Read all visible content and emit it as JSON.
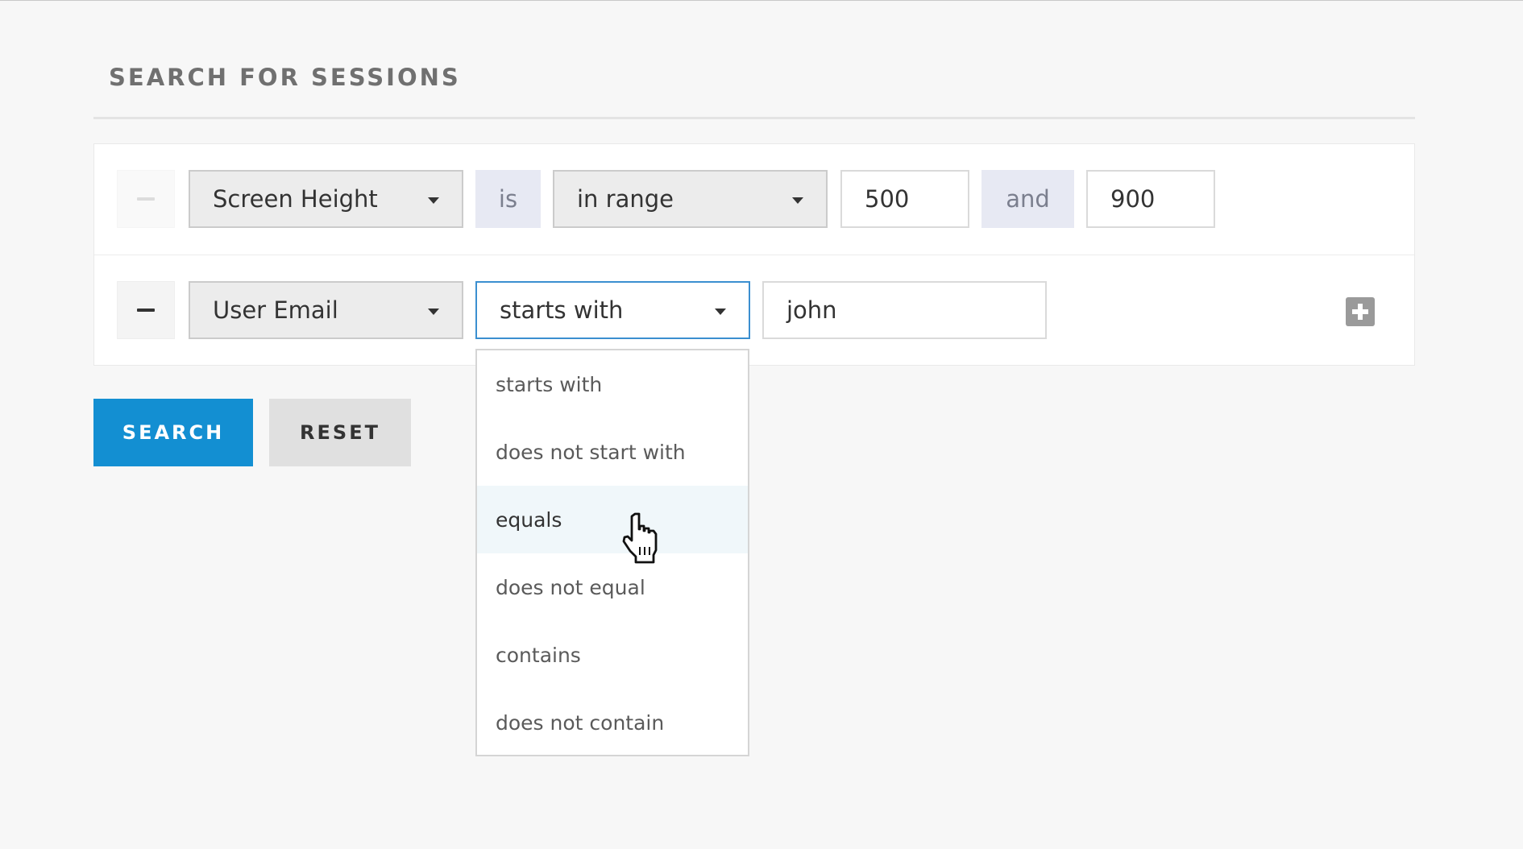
{
  "page": {
    "title": "SEARCH FOR SESSIONS"
  },
  "filters": [
    {
      "field": "Screen Height",
      "connector": "is",
      "operator": "in range",
      "value_from": "500",
      "range_joiner": "and",
      "value_to": "900"
    },
    {
      "field": "User Email",
      "operator": "starts with",
      "value": "john"
    }
  ],
  "operator_dropdown": {
    "options": [
      "starts with",
      "does not start with",
      "equals",
      "does not equal",
      "contains",
      "does not contain"
    ],
    "hovered": "equals"
  },
  "actions": {
    "search_label": "SEARCH",
    "reset_label": "RESET"
  },
  "icons": {
    "remove": "minus-icon",
    "add": "plus-icon",
    "dropdown": "chevron-down-icon",
    "cursor": "hand-pointer-icon"
  },
  "colors": {
    "primary": "#138fd2",
    "focus_border": "#3b8fd0",
    "hover_option": "#f0f7fa"
  }
}
